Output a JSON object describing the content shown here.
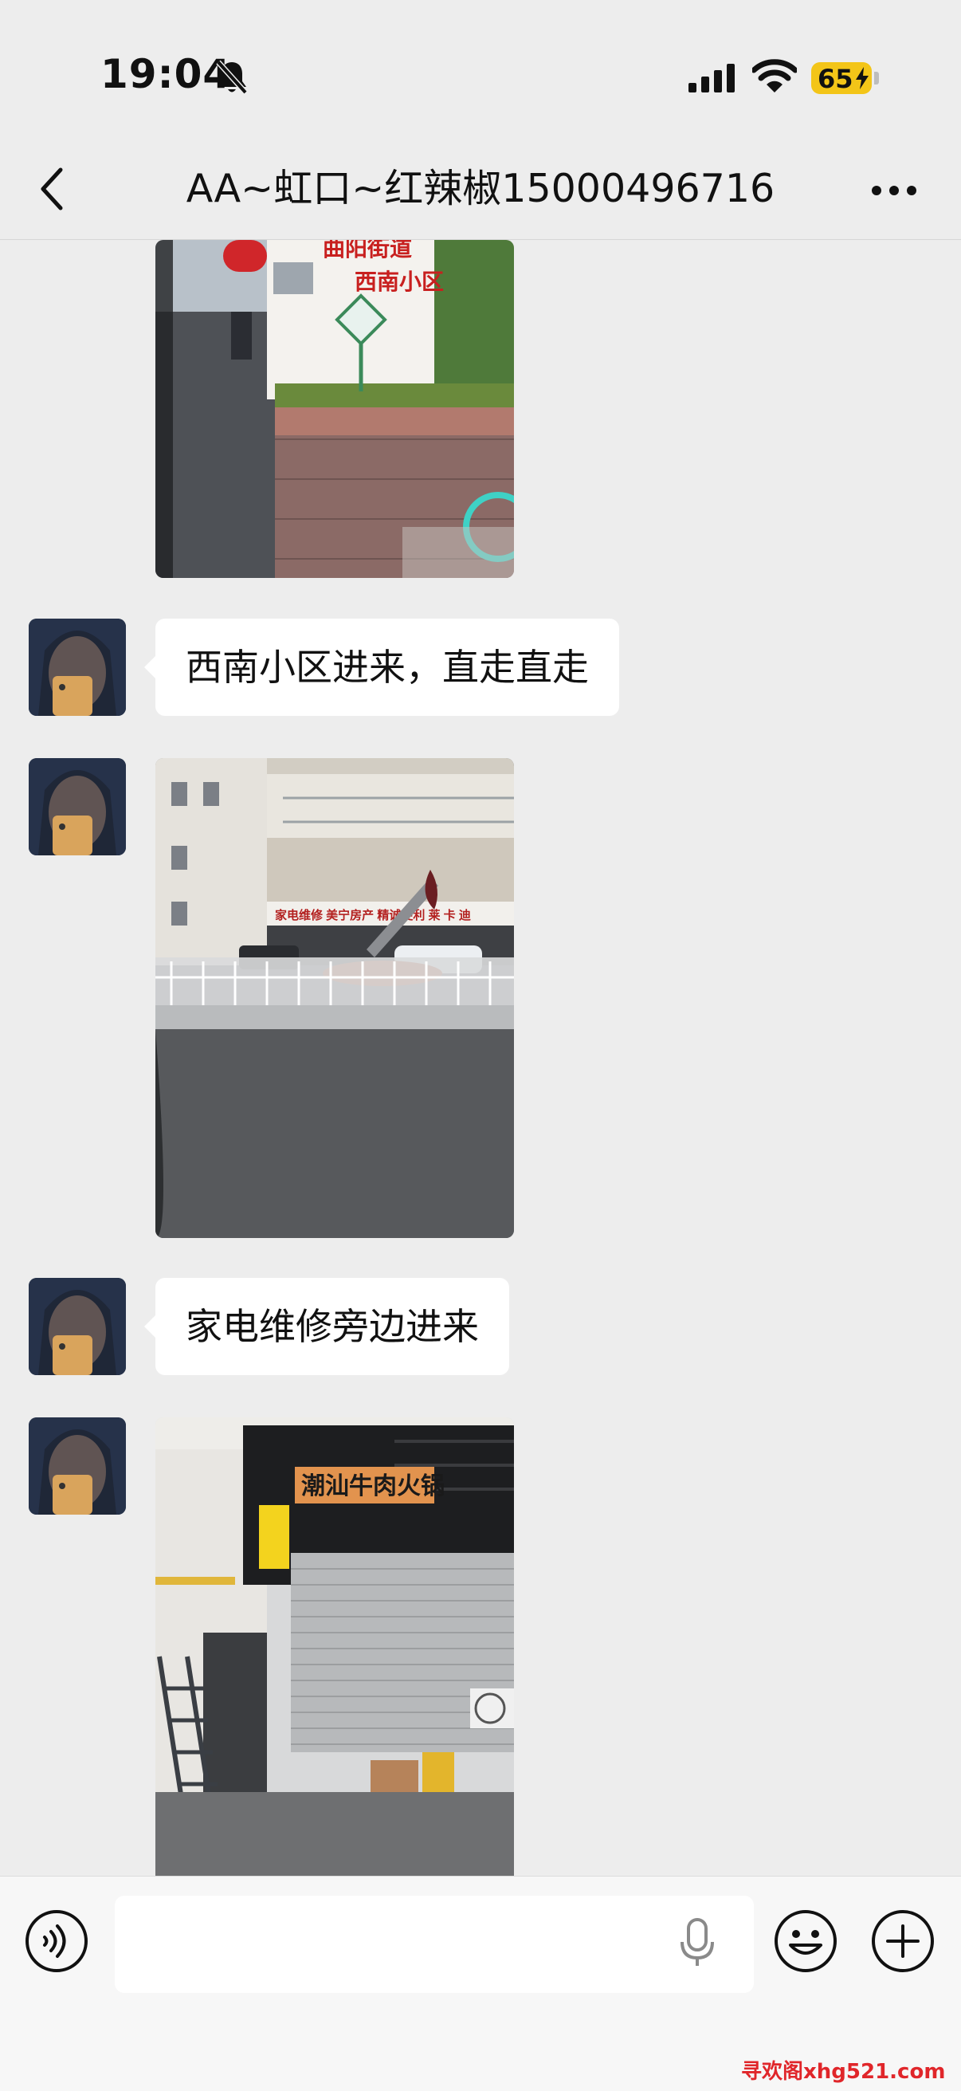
{
  "status_bar": {
    "time": "19:04",
    "battery": "65",
    "icons": [
      "bell-slash-icon",
      "signal-icon",
      "wifi-icon",
      "battery-charging-icon"
    ]
  },
  "nav": {
    "title": "AA~虹口~红辣椒15000496716",
    "back_icon": "chevron-left-icon",
    "more_icon": "more-dots-icon"
  },
  "messages": [
    {
      "type": "image",
      "sender": "contact",
      "image": "photo-residential-entrance",
      "sign_text": "曲阳街道 西南小区"
    },
    {
      "type": "text",
      "sender": "contact",
      "text": "西南小区进来，直走直走"
    },
    {
      "type": "image",
      "sender": "contact",
      "image": "photo-street-with-shops"
    },
    {
      "type": "text",
      "sender": "contact",
      "text": "家电维修旁边进来"
    },
    {
      "type": "image",
      "sender": "contact",
      "image": "photo-shop-front",
      "sign_text": "潮汕牛肉火锅"
    }
  ],
  "input_bar": {
    "placeholder": "",
    "icons": [
      "voice-icon",
      "mic-icon",
      "emoji-icon",
      "plus-icon"
    ]
  },
  "watermark": "寻欢阁xhg521.com",
  "colors": {
    "background": "#ededed",
    "bubble": "#ffffff",
    "battery": "#f3c518",
    "watermark": "#e0262a"
  }
}
